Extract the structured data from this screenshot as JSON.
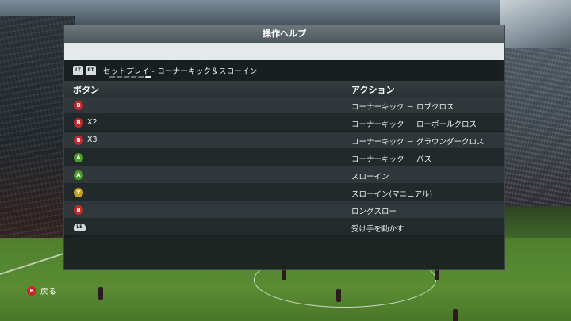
{
  "panel": {
    "title": "操作ヘルプ"
  },
  "category": {
    "trigger_left": "LT",
    "trigger_right": "RT",
    "label": "セットプレイ - コーナーキック＆スローイン",
    "page_dots_total": 6,
    "page_dots_active_index": 5
  },
  "table": {
    "header_button": "ボタン",
    "header_action": "アクション",
    "rows": [
      {
        "button": "B",
        "button_color": "#c5282a",
        "multiplier": "",
        "action": "コーナーキック － ロブクロス"
      },
      {
        "button": "B",
        "button_color": "#c5282a",
        "multiplier": "X2",
        "action": "コーナーキック － ローボールクロス"
      },
      {
        "button": "B",
        "button_color": "#c5282a",
        "multiplier": "X3",
        "action": "コーナーキック － グラウンダークロス"
      },
      {
        "button": "A",
        "button_color": "#4c9a2a",
        "multiplier": "",
        "action": "コーナーキック － パス"
      },
      {
        "button": "A",
        "button_color": "#4c9a2a",
        "multiplier": "",
        "action": "スローイン"
      },
      {
        "button": "Y",
        "button_color": "#c8a21c",
        "multiplier": "",
        "action": "スローイン(マニュアル)"
      },
      {
        "button": "B",
        "button_color": "#c5282a",
        "multiplier": "",
        "action": "ロングスロー"
      },
      {
        "button": "LB",
        "button_color": "#d5d8d8",
        "multiplier": "",
        "action": "受け手を動かす"
      }
    ]
  },
  "footer": {
    "back_button": "B",
    "back_button_color": "#c5282a",
    "back_label": "戻る"
  }
}
